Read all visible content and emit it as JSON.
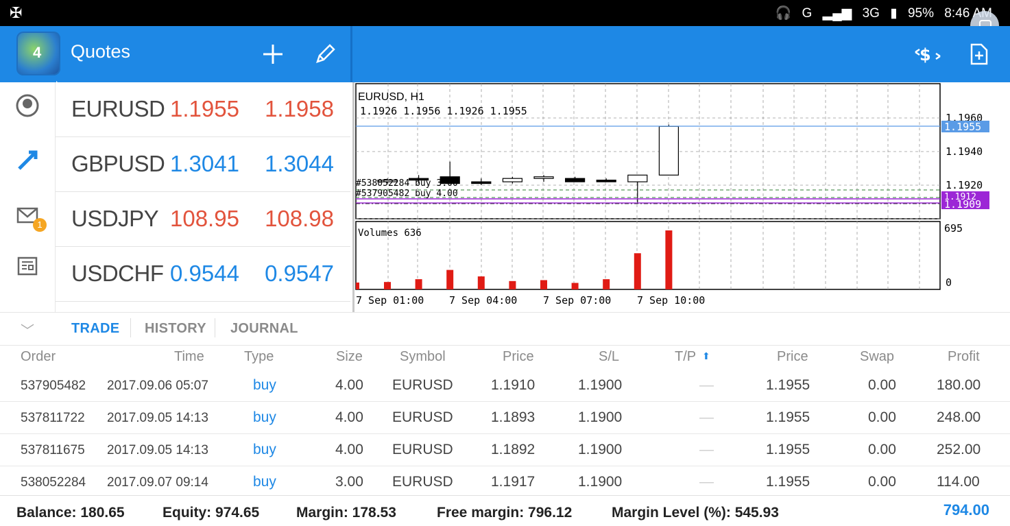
{
  "status_bar": {
    "network": "G",
    "network2": "3G",
    "battery": "95%",
    "time": "8:46 AM"
  },
  "app_bar": {
    "title": "Quotes",
    "add_icon": "plus-icon",
    "edit_icon": "pencil-icon",
    "trade_icon": "dollar-exchange-icon",
    "new_order_icon": "add-document-icon"
  },
  "quotes": [
    {
      "symbol": "EURUSD",
      "bid": "1.1955",
      "ask": "1.1958",
      "color": "#e2533c"
    },
    {
      "symbol": "GBPUSD",
      "bid": "1.3041",
      "ask": "1.3044",
      "color": "#1e88e5"
    },
    {
      "symbol": "USDJPY",
      "bid": "108.95",
      "ask": "108.98",
      "color": "#e2533c"
    },
    {
      "symbol": "USDCHF",
      "bid": "0.9544",
      "ask": "0.9547",
      "color": "#1e88e5"
    }
  ],
  "sidenav": {
    "badge": "1"
  },
  "chart": {
    "title": "EURUSD, H1",
    "ohlc": "1.1926 1.1956 1.1926 1.1955",
    "price_labels": [
      "1.1960",
      "1.1940",
      "1.1920"
    ],
    "current_price": "1.1955",
    "order_price_a": "1.1912",
    "order_price_b": "1.1909",
    "order_label_1": "#538052284 buy 3.00",
    "order_label_2": "#537905482 buy 4.00",
    "volumes_label": "Volumes 636",
    "volume_max": "695",
    "volume_zero": "0",
    "time_labels": [
      "7 Sep 01:00",
      "7 Sep 04:00",
      "7 Sep 07:00",
      "7 Sep 10:00"
    ]
  },
  "chart_data": {
    "type": "candlestick",
    "title": "EURUSD, H1",
    "ylim": [
      1.19,
      1.197
    ],
    "candles": [
      {
        "o": 1.1922,
        "h": 1.1924,
        "l": 1.1921,
        "c": 1.1923
      },
      {
        "o": 1.1924,
        "h": 1.1926,
        "l": 1.1921,
        "c": 1.1923
      },
      {
        "o": 1.1925,
        "h": 1.1934,
        "l": 1.1921,
        "c": 1.1921
      },
      {
        "o": 1.1922,
        "h": 1.1924,
        "l": 1.192,
        "c": 1.1921
      },
      {
        "o": 1.1922,
        "h": 1.1925,
        "l": 1.1921,
        "c": 1.1924
      },
      {
        "o": 1.1924,
        "h": 1.1926,
        "l": 1.1922,
        "c": 1.1925
      },
      {
        "o": 1.1924,
        "h": 1.1925,
        "l": 1.1922,
        "c": 1.1922
      },
      {
        "o": 1.1923,
        "h": 1.1924,
        "l": 1.1922,
        "c": 1.1922
      },
      {
        "o": 1.1922,
        "h": 1.1926,
        "l": 1.1909,
        "c": 1.1926
      },
      {
        "o": 1.1926,
        "h": 1.1956,
        "l": 1.1926,
        "c": 1.1955
      }
    ],
    "volumes": [
      80,
      110,
      210,
      140,
      90,
      100,
      70,
      110,
      390,
      636
    ],
    "volume_ylim": [
      0,
      695
    ]
  },
  "tabs": {
    "trade": "TRADE",
    "history": "HISTORY",
    "journal": "JOURNAL"
  },
  "table": {
    "headers": {
      "order": "Order",
      "time": "Time",
      "type": "Type",
      "size": "Size",
      "symbol": "Symbol",
      "price": "Price",
      "sl": "S/L",
      "tp": "T/P",
      "price2": "Price",
      "swap": "Swap",
      "profit": "Profit"
    },
    "rows": [
      {
        "order": "537905482",
        "time": "2017.09.06 05:07",
        "type": "buy",
        "size": "4.00",
        "symbol": "EURUSD",
        "price": "1.1910",
        "sl": "1.1900",
        "tp": "—",
        "price2": "1.1955",
        "swap": "0.00",
        "profit": "180.00"
      },
      {
        "order": "537811722",
        "time": "2017.09.05 14:13",
        "type": "buy",
        "size": "4.00",
        "symbol": "EURUSD",
        "price": "1.1893",
        "sl": "1.1900",
        "tp": "—",
        "price2": "1.1955",
        "swap": "0.00",
        "profit": "248.00"
      },
      {
        "order": "537811675",
        "time": "2017.09.05 14:13",
        "type": "buy",
        "size": "4.00",
        "symbol": "EURUSD",
        "price": "1.1892",
        "sl": "1.1900",
        "tp": "—",
        "price2": "1.1955",
        "swap": "0.00",
        "profit": "252.00"
      },
      {
        "order": "538052284",
        "time": "2017.09.07 09:14",
        "type": "buy",
        "size": "3.00",
        "symbol": "EURUSD",
        "price": "1.1917",
        "sl": "1.1900",
        "tp": "—",
        "price2": "1.1955",
        "swap": "0.00",
        "profit": "114.00"
      }
    ]
  },
  "footer": {
    "balance": "Balance: 180.65",
    "equity": "Equity: 974.65",
    "margin": "Margin: 178.53",
    "free_margin": "Free margin: 796.12",
    "margin_level": "Margin Level (%): 545.93",
    "total": "794.00"
  }
}
